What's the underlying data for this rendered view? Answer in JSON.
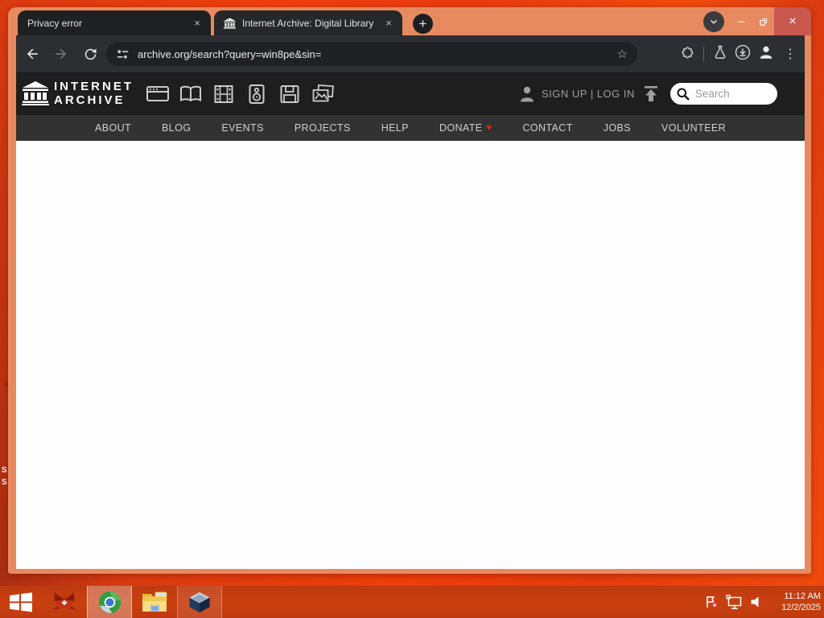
{
  "browser": {
    "tabs": [
      {
        "title": "Privacy error"
      },
      {
        "title": "Internet Archive: Digital Library"
      }
    ],
    "new_tab_glyph": "+",
    "url": "archive.org/search?query=win8pe&sin=",
    "window_controls": {
      "minimize": "–",
      "close": "×"
    },
    "toolbar_icon_names": [
      "back",
      "forward",
      "reload",
      "site-settings",
      "bookmark-star",
      "extensions",
      "labs-flask",
      "downloads",
      "profile",
      "menu"
    ]
  },
  "archive": {
    "wordmark_line1": "INTERNET",
    "wordmark_line2": "ARCHIVE",
    "media_types": [
      "web",
      "texts",
      "video",
      "audio",
      "software",
      "images"
    ],
    "auth": "SIGN UP | LOG IN",
    "search_placeholder": "Search",
    "nav": [
      "ABOUT",
      "BLOG",
      "EVENTS",
      "PROJECTS",
      "HELP",
      "DONATE",
      "CONTACT",
      "JOBS",
      "VOLUNTEER"
    ]
  },
  "taskbar": {
    "time": "11:12 AM",
    "date": "12/2/2025",
    "app_names": [
      "start",
      "red-app",
      "chromium-browser",
      "file-explorer",
      "virtualbox"
    ],
    "tray_icon_names": [
      "action-center-flag",
      "network-display",
      "volume-muted"
    ]
  },
  "desktop": {
    "icon_label_fragments": [
      "s",
      "S",
      "S"
    ]
  },
  "icons": {
    "heart": "♥",
    "star": "☆",
    "menu": "⋮",
    "close_tab": "×"
  },
  "colors": {
    "titlebar": "#e78a60",
    "toolbar": "#2d2e31",
    "omnibox": "#202124",
    "archive_header": "#1e1e1e",
    "archive_nav": "#323232",
    "taskbar": "#c23c10",
    "desktop_red": "#ef3e0b",
    "close_button": "#c8584e",
    "donate_heart": "#e8241c"
  }
}
